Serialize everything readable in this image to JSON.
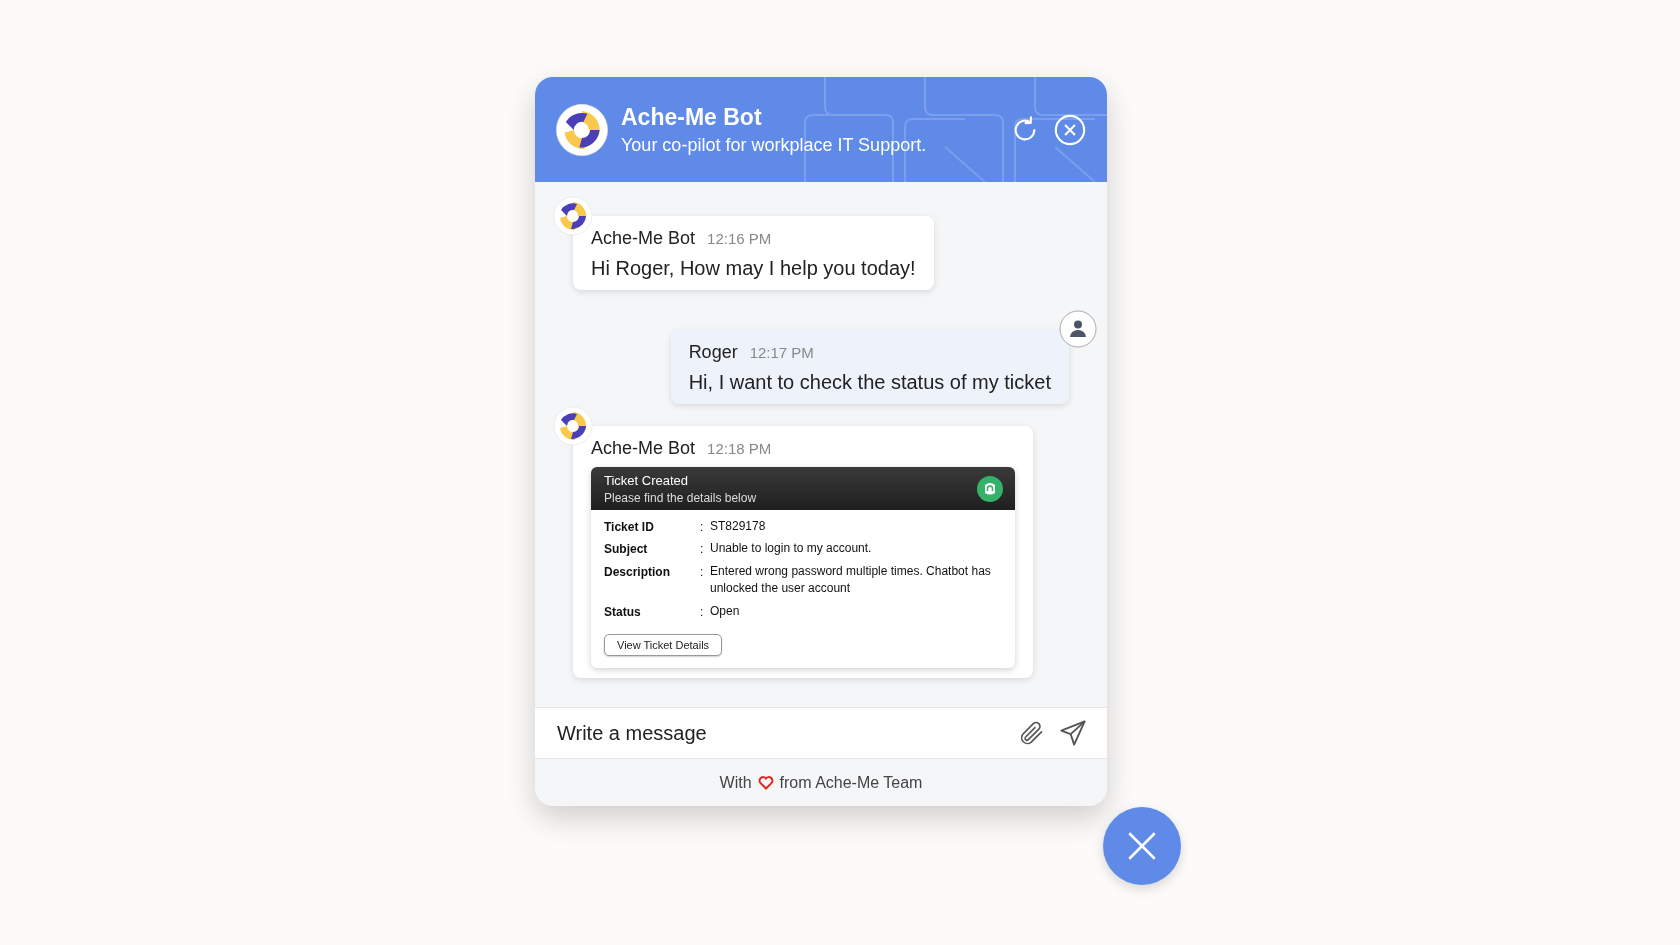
{
  "header": {
    "title": "Ache-Me Bot",
    "subtitle": "Your co-pilot for workplace IT Support."
  },
  "messages": [
    {
      "kind": "bot",
      "sender": "Ache-Me Bot",
      "time": "12:16 PM",
      "text": "Hi Roger, How may I help you today!"
    },
    {
      "kind": "user",
      "sender": "Roger",
      "time": "12:17 PM",
      "text": "Hi, I want to check the status of my ticket"
    },
    {
      "kind": "ticket",
      "sender": "Ache-Me Bot",
      "time": "12:18 PM",
      "ticket": {
        "title": "Ticket Created",
        "subtitle": "Please find the details below",
        "fields": [
          {
            "label": "Ticket ID",
            "separator": ":",
            "value": "ST829178"
          },
          {
            "label": "Subject",
            "separator": ":",
            "value": "Unable to login to my account."
          },
          {
            "label": "Description",
            "separator": ":",
            "value": "Entered wrong password multiple times. Chatbot has unlocked the user account"
          },
          {
            "label": "Status",
            "separator": ":",
            "value": "Open"
          }
        ],
        "button": "View Ticket Details"
      }
    }
  ],
  "composer": {
    "placeholder": "Write a message"
  },
  "footer": {
    "before": "With",
    "after": "from Ache-Me Team"
  }
}
